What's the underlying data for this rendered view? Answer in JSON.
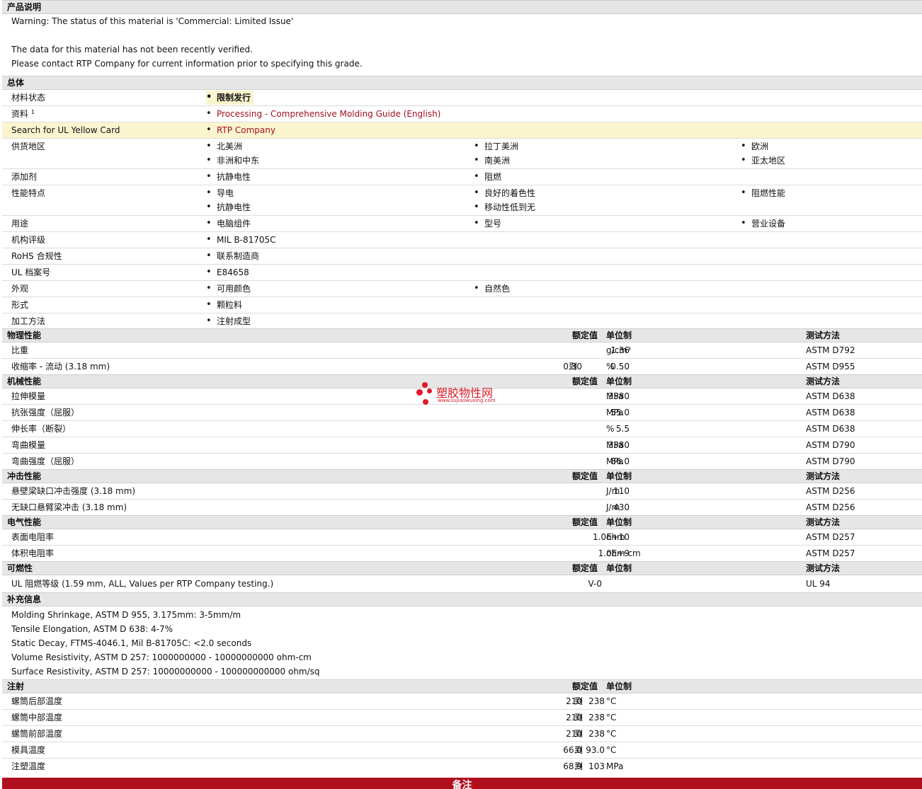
{
  "desc": {
    "title": "产品说明",
    "lines": [
      "Warning: The status of this material is 'Commercial: Limited Issue'",
      "",
      "The data for this material has not been recently verified.",
      "Please contact RTP Company for current information prior to specifying this grade."
    ]
  },
  "general": {
    "title": "总体",
    "material_status": {
      "label": "材料状态",
      "value": "限制发行"
    },
    "docs": {
      "label": "资料",
      "sup": "1",
      "link": "Processing - Comprehensive Molding Guide (English)"
    },
    "ul_card": {
      "label": "Search for UL Yellow Card",
      "link": "RTP Company"
    },
    "region": {
      "label": "供货地区",
      "items": [
        "北美洲",
        "拉丁美洲",
        "欧洲",
        "非洲和中东",
        "南美洲",
        "亚太地区"
      ]
    },
    "additive": {
      "label": "添加剂",
      "items": [
        "抗静电性",
        "阻燃"
      ]
    },
    "features": {
      "label": "性能特点",
      "items": [
        "导电",
        "良好的着色性",
        "阻燃性能",
        "抗静电性",
        "移动性低到无"
      ]
    },
    "uses": {
      "label": "用途",
      "items": [
        "电脑组件",
        "型号",
        "营业设备"
      ]
    },
    "agency": {
      "label": "机构评级",
      "items": [
        "MIL B-81705C"
      ]
    },
    "rohs": {
      "label": "RoHS 合规性",
      "items": [
        "联系制造商"
      ]
    },
    "ul_file": {
      "label": "UL 档案号",
      "items": [
        "E84658"
      ]
    },
    "appearance": {
      "label": "外观",
      "items": [
        "可用颜色",
        "自然色"
      ]
    },
    "form": {
      "label": "形式",
      "items": [
        "颗粒料"
      ]
    },
    "process": {
      "label": "加工方法",
      "items": [
        "注射成型"
      ]
    }
  },
  "headers": {
    "nominal": "额定值",
    "unit": "单位制",
    "test": "测试方法",
    "range_word": "到"
  },
  "physical": {
    "title": "物理性能",
    "rows": [
      {
        "label": "比重",
        "v1": "",
        "v2": "1.36",
        "unit": "g/cm³",
        "test": "ASTM D792"
      },
      {
        "label": "收缩率  - 流动  (3.18 mm)",
        "v1": "0.30",
        "v2": "0.50",
        "unit": "%",
        "test": "ASTM D955"
      }
    ]
  },
  "mechanical": {
    "title": "机械性能",
    "rows": [
      {
        "label": "拉伸模量",
        "v2": "3580",
        "unit": "MPa",
        "test": "ASTM D638"
      },
      {
        "label": "抗张强度（屈服）",
        "v2": "55.0",
        "unit": "MPa",
        "test": "ASTM D638"
      },
      {
        "label": "伸长率（断裂）",
        "v2": "5.5",
        "unit": "%",
        "test": "ASTM D638"
      },
      {
        "label": "弯曲模量",
        "v2": "3580",
        "unit": "MPa",
        "test": "ASTM D790"
      },
      {
        "label": "弯曲强度（屈服）",
        "v2": "86.0",
        "unit": "MPa",
        "test": "ASTM D790"
      }
    ]
  },
  "impact": {
    "title": "冲击性能",
    "rows": [
      {
        "label": "悬壁梁缺口冲击强度  (3.18 mm)",
        "v2": "110",
        "unit": "J/m",
        "test": "ASTM D256"
      },
      {
        "label": "无缺口悬臂梁冲击  (3.18 mm)",
        "v2": "430",
        "unit": "J/m",
        "test": "ASTM D256"
      }
    ]
  },
  "electrical": {
    "title": "电气性能",
    "rows": [
      {
        "label": "表面电阻率",
        "v2": "1.0E+10",
        "unit": "ohm",
        "test": "ASTM D257"
      },
      {
        "label": "体积电阻率",
        "v2": "1.0E+9",
        "unit": "ohm·cm",
        "test": "ASTM D257"
      }
    ]
  },
  "flammability": {
    "title": "可燃性",
    "rows": [
      {
        "label": "UL 阻燃等级  (1.59 mm, ALL, Values per RTP Company testing.)",
        "value": "V-0",
        "test": "UL 94"
      }
    ]
  },
  "supplement": {
    "title": "补充信息",
    "lines": [
      "Molding Shrinkage, ASTM D 955, 3.175mm: 3-5mm/m",
      "Tensile Elongation, ASTM D 638: 4-7%",
      "Static Decay, FTMS-4046.1, Mil B-81705C: <2.0 seconds",
      "Volume Resistivity, ASTM D 257: 1000000000 - 10000000000 ohm-cm",
      "Surface Resistivity, ASTM D 257: 10000000000 - 100000000000 ohm/sq"
    ]
  },
  "injection": {
    "title": "注射",
    "rows": [
      {
        "label": "螺筒后部温度",
        "v1": "210",
        "v2": "238",
        "unit": "°C"
      },
      {
        "label": "螺筒中部温度",
        "v1": "210",
        "v2": "238",
        "unit": "°C"
      },
      {
        "label": "螺筒前部温度",
        "v1": "210",
        "v2": "238",
        "unit": "°C"
      },
      {
        "label": "模具温度",
        "v1": "66.0",
        "v2": "93.0",
        "unit": "°C"
      },
      {
        "label": "注塑温度",
        "v1": "68.9",
        "v2": "103",
        "unit": "MPa"
      }
    ]
  },
  "footer": {
    "label": "备注"
  },
  "watermark": {
    "name": "塑胶物性网",
    "url": "www.sujiaowuxing.com"
  }
}
